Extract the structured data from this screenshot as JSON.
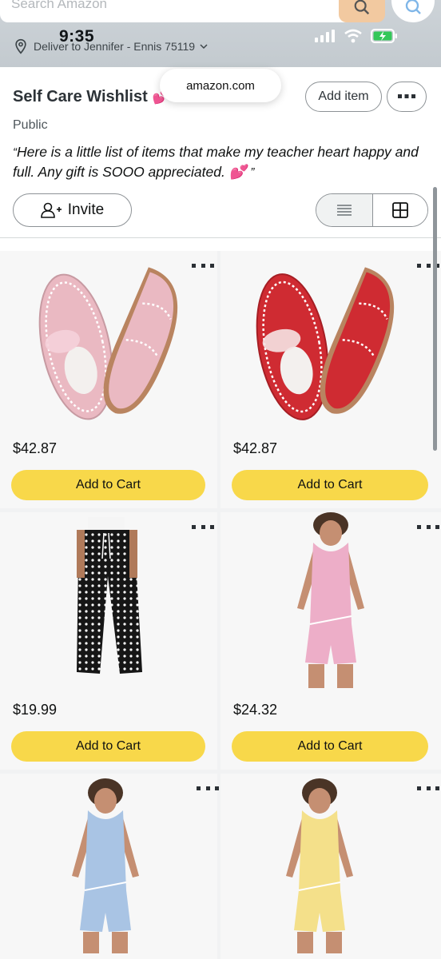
{
  "status_bar": {
    "time": "9:35"
  },
  "search": {
    "placeholder": "Search Amazon"
  },
  "location": {
    "deliver_text": "Deliver to Jennifer - Ennis 75119"
  },
  "browser": {
    "url": "amazon.com"
  },
  "list": {
    "title": "Self Care Wishlist",
    "title_emoji": "💕",
    "privacy": "Public",
    "note": "Here is a little list of items that make my teacher heart happy and full. Any gift is SOOO appreciated. 💕",
    "add_item_label": "Add item",
    "invite_label": "Invite"
  },
  "products": [
    {
      "price": "$42.87",
      "button_label": "Add to Cart",
      "image": "pink-suede-sneakers"
    },
    {
      "price": "$42.87",
      "button_label": "Add to Cart",
      "image": "red-suede-sneakers"
    },
    {
      "price": "$19.99",
      "button_label": "Add to Cart",
      "image": "polka-dot-pants"
    },
    {
      "price": "$24.32",
      "button_label": "Add to Cart",
      "image": "pink-tank-shorts-set"
    },
    {
      "price": "",
      "button_label": "",
      "image": "blue-tank-shorts-set"
    },
    {
      "price": "",
      "button_label": "",
      "image": "yellow-tank-shorts-set"
    }
  ],
  "colors": {
    "add_to_cart": "#f8d84a",
    "status_bar": "#c8ced3",
    "battery": "#34c759"
  }
}
